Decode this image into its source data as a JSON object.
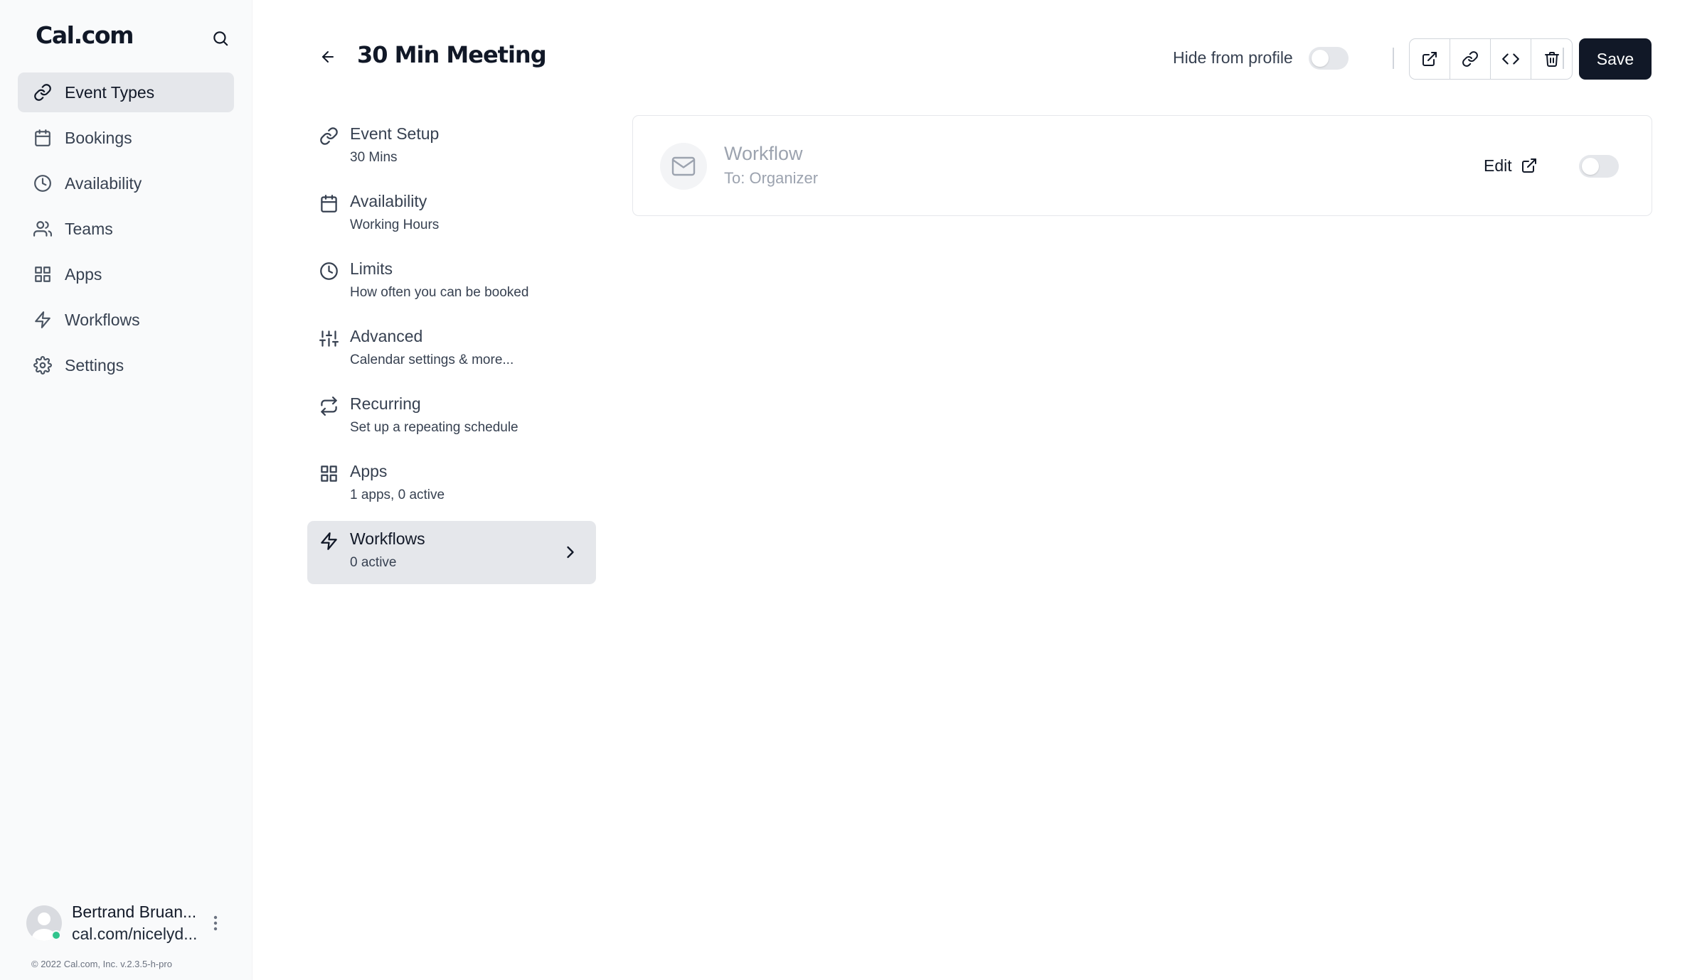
{
  "brand": {
    "name": "Cal.com"
  },
  "sidebar": {
    "items": [
      {
        "label": "Event Types",
        "icon": "link-icon",
        "active": true
      },
      {
        "label": "Bookings",
        "icon": "calendar-icon",
        "active": false
      },
      {
        "label": "Availability",
        "icon": "clock-icon",
        "active": false
      },
      {
        "label": "Teams",
        "icon": "users-icon",
        "active": false
      },
      {
        "label": "Apps",
        "icon": "grid-icon",
        "active": false
      },
      {
        "label": "Workflows",
        "icon": "zap-icon",
        "active": false
      },
      {
        "label": "Settings",
        "icon": "gear-icon",
        "active": false
      }
    ]
  },
  "profile": {
    "name": "Bertrand Bruan...",
    "url": "cal.com/nicelyd...",
    "status": "online"
  },
  "footer": {
    "copyright": "© 2022 Cal.com, Inc. v.2.3.5-h-pro"
  },
  "header": {
    "title": "30 Min Meeting",
    "hide_from_profile_label": "Hide from profile",
    "hide_from_profile_enabled": false,
    "actions": [
      "external-link-icon",
      "link-icon",
      "code-icon",
      "trash-icon"
    ],
    "save_label": "Save"
  },
  "tabs": [
    {
      "label": "Event Setup",
      "description": "30 Mins",
      "icon": "link-icon",
      "active": false
    },
    {
      "label": "Availability",
      "description": "Working Hours",
      "icon": "calendar-icon",
      "active": false
    },
    {
      "label": "Limits",
      "description": "How often you can be booked",
      "icon": "clock-icon",
      "active": false
    },
    {
      "label": "Advanced",
      "description": "Calendar settings & more...",
      "icon": "sliders-icon",
      "active": false
    },
    {
      "label": "Recurring",
      "description": "Set up a repeating schedule",
      "icon": "repeat-icon",
      "active": false
    },
    {
      "label": "Apps",
      "description": "1 apps, 0 active",
      "icon": "grid-icon",
      "active": false
    },
    {
      "label": "Workflows",
      "description": "0 active",
      "icon": "zap-icon",
      "active": true
    }
  ],
  "workflow": {
    "title": "Workflow",
    "subtitle": "To: Organizer",
    "edit_label": "Edit",
    "enabled": false
  },
  "colors": {
    "primary": "#111827",
    "sidebar_bg": "#f9fafb",
    "active_bg": "#e5e7eb",
    "muted_text": "#9ca3af",
    "online": "#31c48d"
  }
}
